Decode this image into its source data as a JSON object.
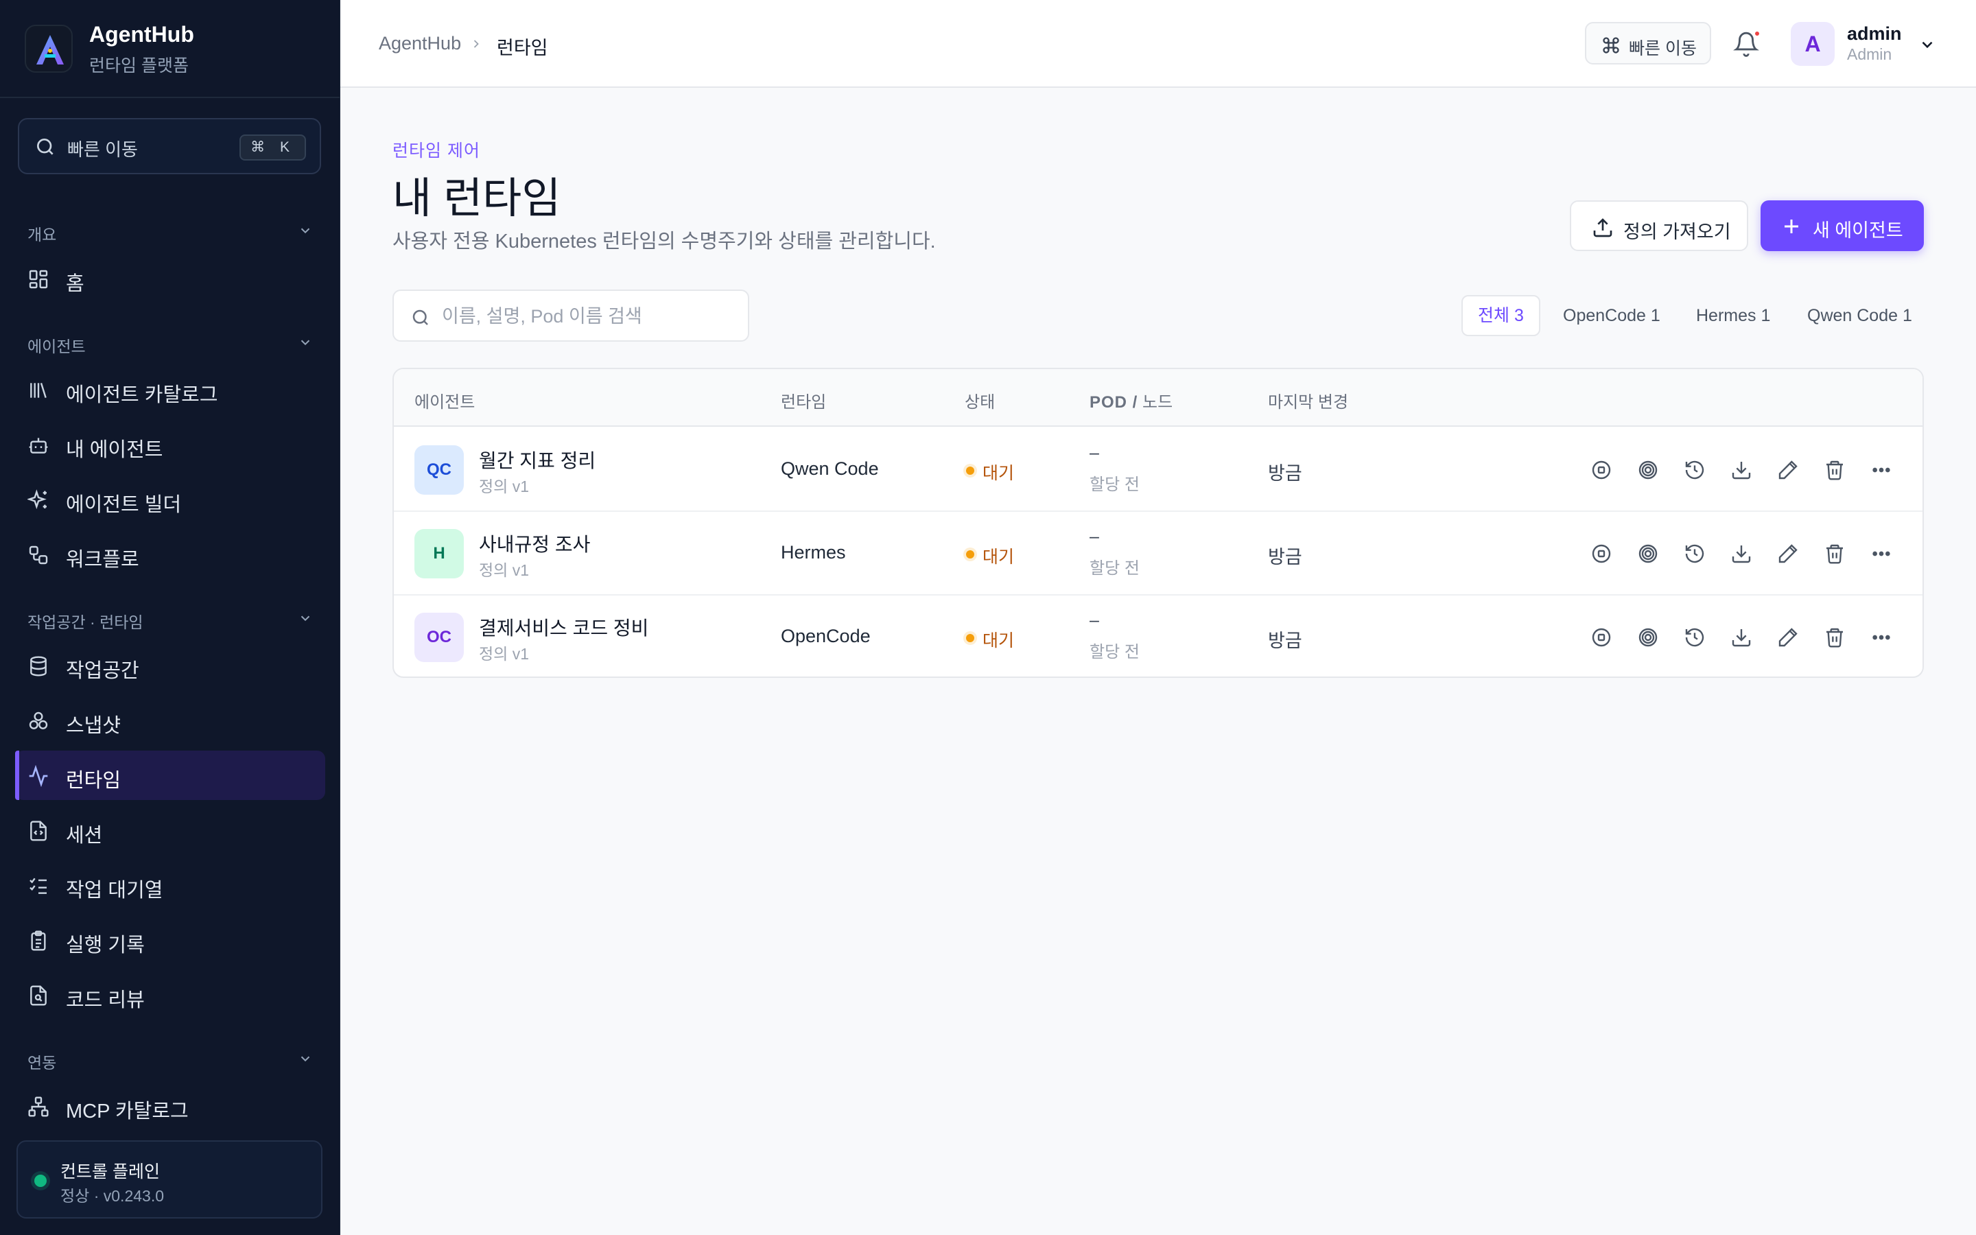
{
  "app": {
    "name": "AgentHub",
    "subtitle": "런타임 플랫폼"
  },
  "sidebar": {
    "search_label": "빠른 이동",
    "search_shortcut": "⌘ K",
    "sections": {
      "overview": "개요",
      "agents": "에이전트",
      "workspace": "작업공간 · 런타임",
      "integrations": "연동"
    },
    "items": [
      {
        "label": "홈",
        "icon": "grid-icon"
      },
      {
        "label": "에이전트 카탈로그",
        "icon": "library-icon"
      },
      {
        "label": "내 에이전트",
        "icon": "bot-icon"
      },
      {
        "label": "에이전트 빌더",
        "icon": "sparkles-icon"
      },
      {
        "label": "워크플로",
        "icon": "workflow-icon"
      },
      {
        "label": "작업공간",
        "icon": "database-icon"
      },
      {
        "label": "스냅샷",
        "icon": "boxes-icon"
      },
      {
        "label": "런타임",
        "icon": "activity-icon",
        "active": true
      },
      {
        "label": "세션",
        "icon": "file-code-icon"
      },
      {
        "label": "작업 대기열",
        "icon": "list-checks-icon"
      },
      {
        "label": "실행 기록",
        "icon": "clipboard-icon"
      },
      {
        "label": "코드 리뷰",
        "icon": "file-search-icon"
      },
      {
        "label": "MCP 카탈로그",
        "icon": "network-icon"
      }
    ],
    "status": {
      "title": "컨트롤 플레인",
      "detail": "정상 · v0.243.0",
      "color": "#10b981"
    }
  },
  "topbar": {
    "breadcrumb": [
      "AgentHub",
      "런타임"
    ],
    "quick_label": "빠른 이동",
    "user": {
      "initial": "A",
      "name": "admin",
      "role": "Admin"
    }
  },
  "page": {
    "eyebrow": "런타임 제어",
    "title": "내 런타임",
    "description": "사용자 전용 Kubernetes 런타임의 수명주기와 상태를 관리합니다.",
    "import_label": "정의 가져오기",
    "new_label": "새 에이전트",
    "search_placeholder": "이름, 설명, Pod 이름 검색",
    "search_value": "",
    "filters": [
      "전체 3",
      "OpenCode 1",
      "Hermes 1",
      "Qwen Code 1"
    ],
    "accent": "#6d4aff"
  },
  "table": {
    "headers": {
      "agent": "에이전트",
      "runtime": "런타임",
      "status": "상태",
      "pod_a": "POD /",
      "pod_b": " 노드",
      "changed": "마지막 변경"
    },
    "rows": [
      {
        "badge": "QC",
        "name": "월간 지표 정리",
        "version": "정의 v1",
        "runtime": "Qwen Code",
        "status": "대기",
        "pod": "–",
        "pod_note": "할당 전",
        "changed": "방금"
      },
      {
        "badge": "H",
        "name": "사내규정 조사",
        "version": "정의 v1",
        "runtime": "Hermes",
        "status": "대기",
        "pod": "–",
        "pod_note": "할당 전",
        "changed": "방금"
      },
      {
        "badge": "OC",
        "name": "결제서비스 코드 정비",
        "version": "정의 v1",
        "runtime": "OpenCode",
        "status": "대기",
        "pod": "–",
        "pod_note": "할당 전",
        "changed": "방금"
      }
    ],
    "row_actions": [
      "stop-icon",
      "target-icon",
      "history-icon",
      "download-icon",
      "edit-icon",
      "trash-icon",
      "more-icon"
    ]
  }
}
